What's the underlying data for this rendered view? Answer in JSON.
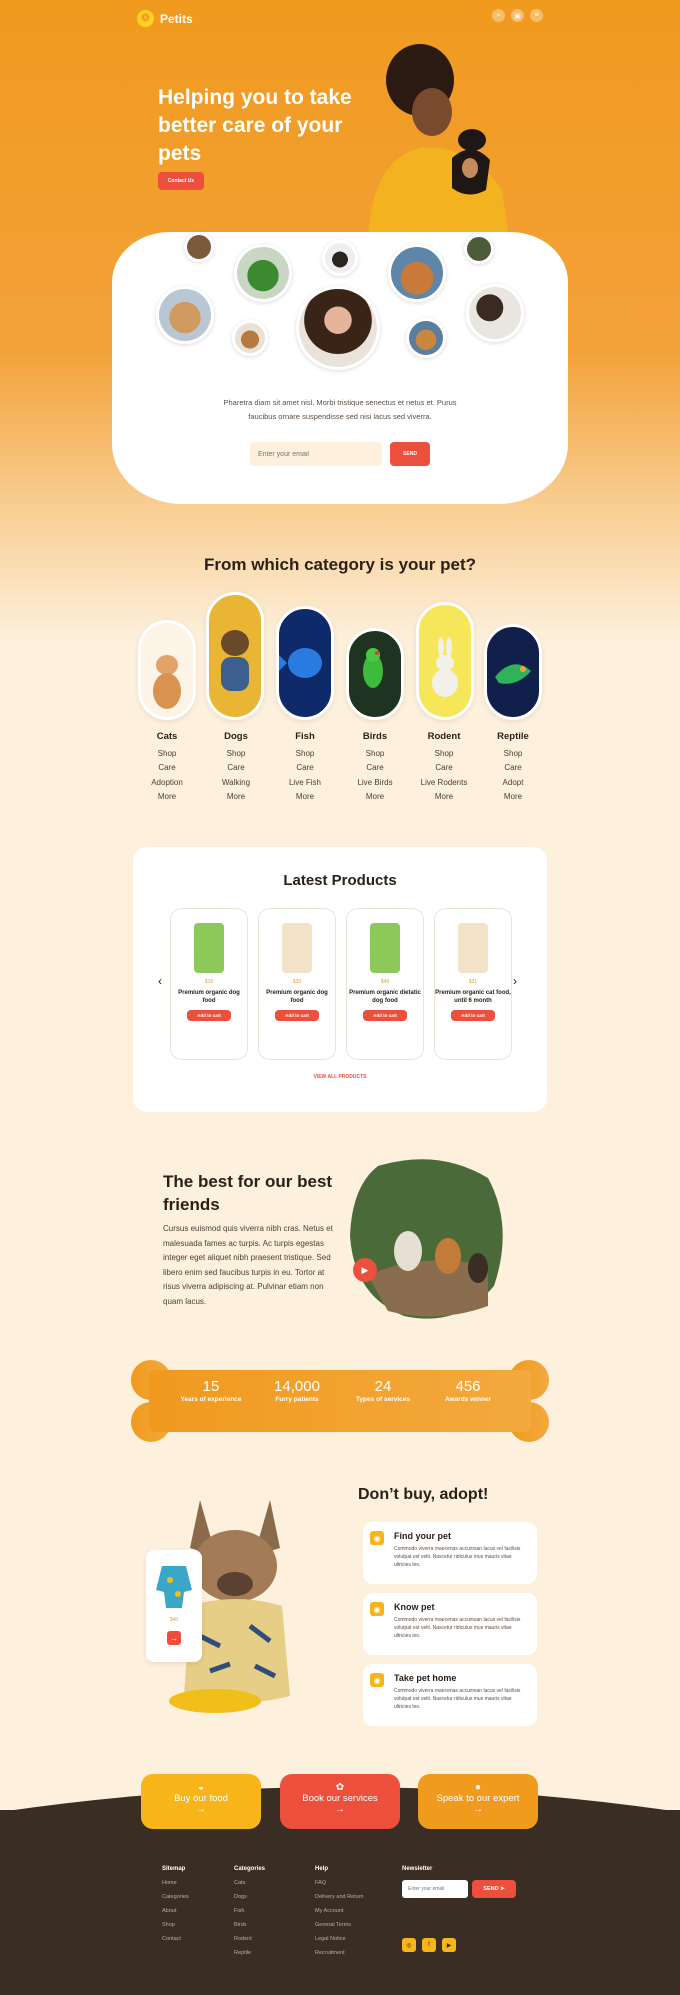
{
  "header": {
    "logo_text": "Petits",
    "icons": [
      "search-icon",
      "cart-icon",
      "menu-icon"
    ]
  },
  "hero": {
    "title": "Helping you to take better care of your pets",
    "cta_label": "Contact Us",
    "text": "Pharetra diam sit amet nisl. Morbi tristique senectus et netus et. Purus faucibus ornare suspendisse sed nisi lacus sed viverra.",
    "email_placeholder": "Enter your email",
    "send_label": "SEND"
  },
  "categories": {
    "title": "From which category is your pet?",
    "items": [
      {
        "name": "Cats",
        "links": [
          "Shop",
          "Care",
          "Adoption",
          "More"
        ]
      },
      {
        "name": "Dogs",
        "links": [
          "Shop",
          "Care",
          "Walking",
          "More"
        ]
      },
      {
        "name": "Fish",
        "links": [
          "Shop",
          "Care",
          "Live Fish",
          "More"
        ]
      },
      {
        "name": "Birds",
        "links": [
          "Shop",
          "Care",
          "Live Birds",
          "More"
        ]
      },
      {
        "name": "Rodent",
        "links": [
          "Shop",
          "Care",
          "Live Rodents",
          "More"
        ]
      },
      {
        "name": "Reptile",
        "links": [
          "Shop",
          "Care",
          "Adopt",
          "More"
        ]
      }
    ]
  },
  "products": {
    "title": "Latest Products",
    "items": [
      {
        "price": "$16",
        "name": "Premium organic dog food",
        "add": "Add to cart"
      },
      {
        "price": "$33",
        "name": "Premium organic dog food",
        "add": "Add to cart"
      },
      {
        "price": "$49",
        "name": "Premium organic dietatic dog food",
        "add": "Add to cart"
      },
      {
        "price": "$31",
        "name": "Premium organic cat food, until 6 month",
        "add": "Add to cart"
      }
    ],
    "view_all": "VIEW ALL PRODUCTS"
  },
  "best": {
    "title": "The best for our best friends",
    "text": "Cursus euismod quis viverra nibh cras. Netus et malesuada fames ac turpis. Ac turpis egestas integer eget aliquet nibh praesent tristique. Sed libero enim sed faucibus turpis in eu. Tortor at risus viverra adipiscing at. Pulvinar etiam non quam lacus."
  },
  "stats": [
    {
      "value": "15",
      "label": "Years of experience"
    },
    {
      "value": "14,000",
      "label": "Furry patients"
    },
    {
      "value": "24",
      "label": "Types of services"
    },
    {
      "value": "456",
      "label": "Awards winner"
    }
  ],
  "adopt": {
    "title": "Don’t buy, adopt!",
    "price": "$40",
    "steps": [
      {
        "title": "Find your pet",
        "text": "Commodo viverra maecenas accumsan lacus vel facilisis volutpat est velit. Nascetur ridiculus mus mauris vitae ultricies leo."
      },
      {
        "title": "Know pet",
        "text": "Commodo viverra maecenas accumsan lacus vel facilisis volutpat est velit. Nascetur ridiculus mus mauris vitae ultricies leo."
      },
      {
        "title": "Take pet home",
        "text": "Commodo viverra maecenas accumsan lacus vel facilisis volutpat est velit. Nascetur ridiculus mus mauris vitae ultricies leo."
      }
    ]
  },
  "cta": [
    {
      "label": "Buy our food",
      "icon": "bowl-icon",
      "color": "#f7b51a"
    },
    {
      "label": "Book our services",
      "icon": "spa-icon",
      "color": "#ec4f3c"
    },
    {
      "label": "Speak to our expert",
      "icon": "user-icon",
      "color": "#f09a1e"
    }
  ],
  "footer": {
    "sitemap": {
      "title": "Sitemap",
      "links": [
        "Home",
        "Categories",
        "About",
        "Shop",
        "Contact"
      ]
    },
    "categories": {
      "title": "Categories",
      "links": [
        "Cats",
        "Dogs",
        "Fish",
        "Birds",
        "Rodent",
        "Reptile"
      ]
    },
    "help": {
      "title": "Help",
      "links": [
        "FAQ",
        "Delivery and Return",
        "My Account",
        "General Terms",
        "Legal Notice",
        "Recruitment"
      ]
    },
    "newsletter": {
      "title": "Newsletter",
      "placeholder": "Enter your email",
      "send": "SEND"
    },
    "social": [
      "instagram-icon",
      "facebook-icon",
      "youtube-icon"
    ]
  },
  "colors": {
    "orange": "#f09a1e",
    "red": "#ec4f3c",
    "yellow": "#f7b51a",
    "cream": "#fdf0dc",
    "dark": "#3a2e24"
  }
}
